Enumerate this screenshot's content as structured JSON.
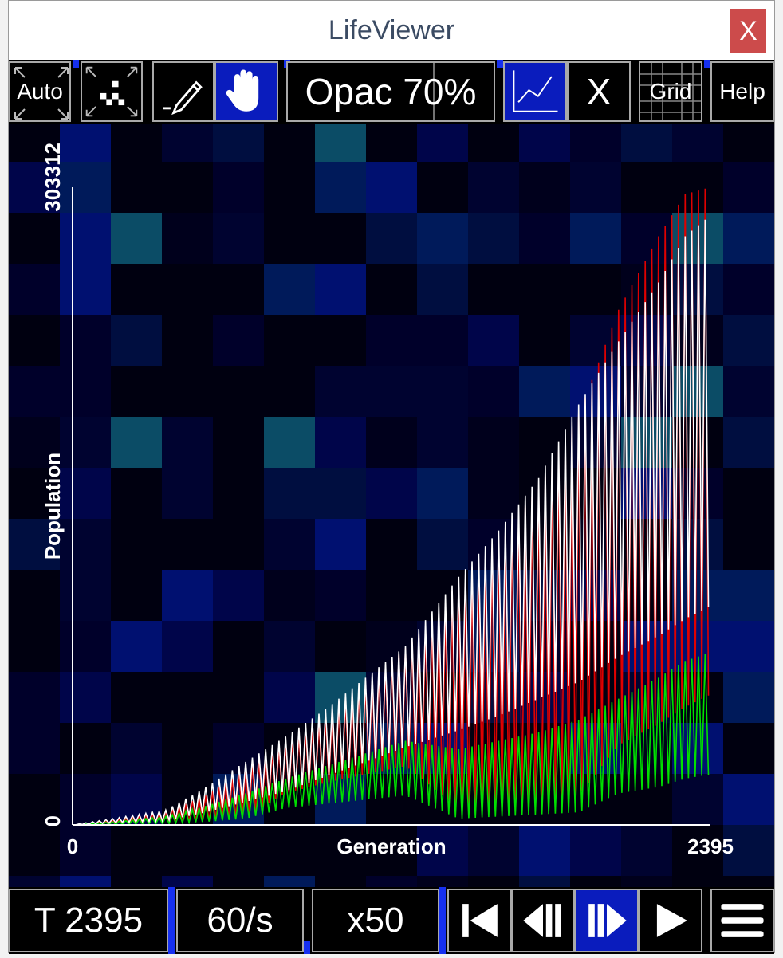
{
  "window": {
    "title": "LifeViewer",
    "close_label": "X"
  },
  "toolbar": {
    "auto_label": "Auto",
    "fit_icon": "pixel-zoom-icon",
    "draw_icon": "pencil-icon",
    "pan_icon": "hand-icon",
    "opacity_label": "Opac 70%",
    "opacity_value": 0.7,
    "graph_icon": "graph-icon",
    "close_graph_label": "X",
    "grid_label": "Grid",
    "help_label": "Help"
  },
  "bottombar": {
    "generation_label": "T 2395",
    "speed_label": "60/s",
    "step_label": "x50",
    "reset_icon": "skip-to-start-icon",
    "step_back_icon": "step-back-icon",
    "step_forward_icon": "step-forward-icon",
    "play_icon": "play-icon",
    "menu_icon": "hamburger-menu-icon"
  },
  "colors": {
    "background": "#000010",
    "button_active": "#0a1cbd",
    "population_series": "#ffffff",
    "births_series": "#00e000",
    "deaths_series": "#e00000"
  },
  "chart_data": {
    "type": "line",
    "title": "",
    "xlabel": "Generation",
    "ylabel": "Population",
    "xlim": [
      0,
      2395
    ],
    "ylim": [
      0,
      303312
    ],
    "x_tick_labels": [
      "0",
      "2395"
    ],
    "y_tick_labels": [
      "0",
      "303312"
    ],
    "grid": false,
    "legend": "none",
    "series": [
      {
        "color": "#ffffff",
        "x": [
          0,
          150,
          350,
          500,
          650,
          800,
          950,
          1100,
          1250,
          1450,
          1600,
          1750,
          1900,
          2050,
          2200,
          2300,
          2395
        ],
        "peak": [
          0,
          3000,
          7000,
          18000,
          30000,
          42000,
          55000,
          70000,
          85000,
          118000,
          140000,
          165000,
          200000,
          230000,
          258000,
          280000,
          290000
        ],
        "trough": [
          0,
          1000,
          2000,
          6000,
          11000,
          16000,
          23000,
          30000,
          37000,
          45000,
          52000,
          60000,
          68000,
          80000,
          90000,
          98000,
          104000
        ]
      },
      {
        "color": "#e00000",
        "x": [
          0,
          150,
          350,
          500,
          650,
          800,
          950,
          1100,
          1250,
          1450,
          1600,
          1750,
          1900,
          2050,
          2200,
          2300,
          2395
        ],
        "peak": [
          0,
          2000,
          6000,
          14000,
          26000,
          38000,
          50000,
          66000,
          84000,
          110000,
          135000,
          160000,
          195000,
          245000,
          280000,
          300000,
          303312
        ],
        "trough": [
          0,
          500,
          1000,
          2000,
          4000,
          15000,
          20000,
          24000,
          28000,
          8000,
          10000,
          12000,
          14000,
          38000,
          48000,
          56000,
          62000
        ]
      },
      {
        "color": "#00e000",
        "x": [
          0,
          150,
          350,
          500,
          650,
          800,
          950,
          1100,
          1250,
          1450,
          1600,
          1750,
          1900,
          2050,
          2200,
          2300,
          2395
        ],
        "peak": [
          0,
          1500,
          4000,
          9000,
          15000,
          22000,
          28000,
          34000,
          40000,
          36000,
          40000,
          44000,
          50000,
          60000,
          70000,
          78000,
          82000
        ],
        "trough": [
          0,
          200,
          600,
          1500,
          3000,
          8000,
          10000,
          12000,
          14000,
          3000,
          4000,
          5000,
          6000,
          15000,
          18000,
          22000,
          24000
        ]
      }
    ]
  }
}
